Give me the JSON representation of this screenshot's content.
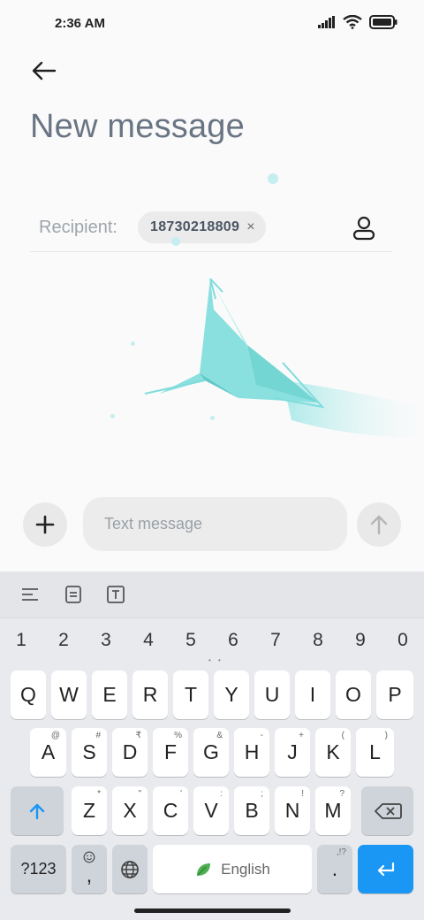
{
  "status_bar": {
    "time": "2:36 AM"
  },
  "header": {
    "title": "New message"
  },
  "recipient": {
    "label": "Recipient:",
    "chip_number": "18730218809",
    "chip_close": "×"
  },
  "compose": {
    "placeholder": "Text message"
  },
  "keyboard": {
    "number_row": [
      "1",
      "2",
      "3",
      "4",
      "5",
      "6",
      "7",
      "8",
      "9",
      "0"
    ],
    "row1": [
      "Q",
      "W",
      "E",
      "R",
      "T",
      "Y",
      "U",
      "I",
      "O",
      "P"
    ],
    "row2": [
      "A",
      "S",
      "D",
      "F",
      "G",
      "H",
      "J",
      "K",
      "L"
    ],
    "row2_hints": [
      "@",
      "#",
      "₹",
      "%",
      "&",
      "-",
      "+",
      "(",
      ")"
    ],
    "row3": [
      "Z",
      "X",
      "C",
      "V",
      "B",
      "N",
      "M"
    ],
    "row3_hints": [
      "*",
      "\"",
      "'",
      ":",
      ";",
      "!",
      "?"
    ],
    "symbols_label": "?123",
    "comma_label": ",",
    "space_label": "English",
    "period_label": ".",
    "period_hint": ",!?",
    "page_dots": "• •"
  },
  "colors": {
    "accent": "#1a96f5",
    "illustration": "#7fdcdc",
    "title": "#6a7584"
  }
}
